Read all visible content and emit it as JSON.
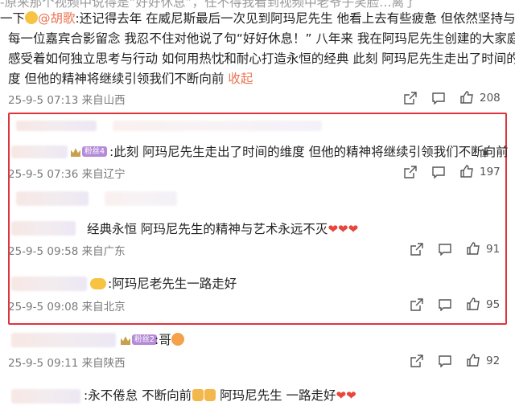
{
  "post": {
    "line1": "-原来那个视频中说得是“好好休息”，任不得我看到视频中老爷子笑脸…离了",
    "line2_prefix": "一下",
    "mention": "@胡歌",
    "line2_rest": ":还记得去年 在威尼斯最后一次见到阿玛尼先生 他看上去有些疲惫 但依然坚持与",
    "line3": "每一位嘉宾合影留念 我忍不住对他说了句“好好休息！” 八年来 我在阿玛尼先生创建的大家庭里",
    "line4": "感受着如何独立思考与行动 如何用热忱和耐心打造永恒的经典 此刻 阿玛尼先生走出了时间的维",
    "line5": "度 但他的精神将继续引领我们不断向前",
    "collapse_label": "收起",
    "meta": "25-9-5 07:13 来自山西",
    "likes": "208"
  },
  "replies": [
    {
      "badge": "粉丝4",
      "text": ":此刻 阿玛尼先生走出了时间的维度 但他的精神将继续引领我们不断向前",
      "meta": "25-9-5 07:36 来自辽宁",
      "likes": "197"
    },
    {
      "text": "经典永恒  阿玛尼先生的精神与艺术永远不灭",
      "meta": "25-9-5 09:58 来自广东",
      "likes": "91"
    },
    {
      "text": ":阿玛尼老先生一路走好",
      "meta": "25-9-5 09:08 来自北京",
      "likes": "95"
    },
    {
      "badge": "粉丝2",
      "text": ":哥",
      "meta": "25-9-5 09:11 来自陕西",
      "likes": "92"
    },
    {
      "text": ":永不倦怠 不断向前",
      "text2": " 阿玛尼先生 一路走好",
      "meta": "",
      "likes": ""
    }
  ],
  "colors": {
    "link": "#eb7350",
    "highlight_frame": "#e0343d",
    "meta_text": "#7b7b7b",
    "heart": "#e8453c"
  },
  "icons": [
    "share-icon",
    "comment-icon",
    "like-icon",
    "heart-icon",
    "crown-icon"
  ]
}
